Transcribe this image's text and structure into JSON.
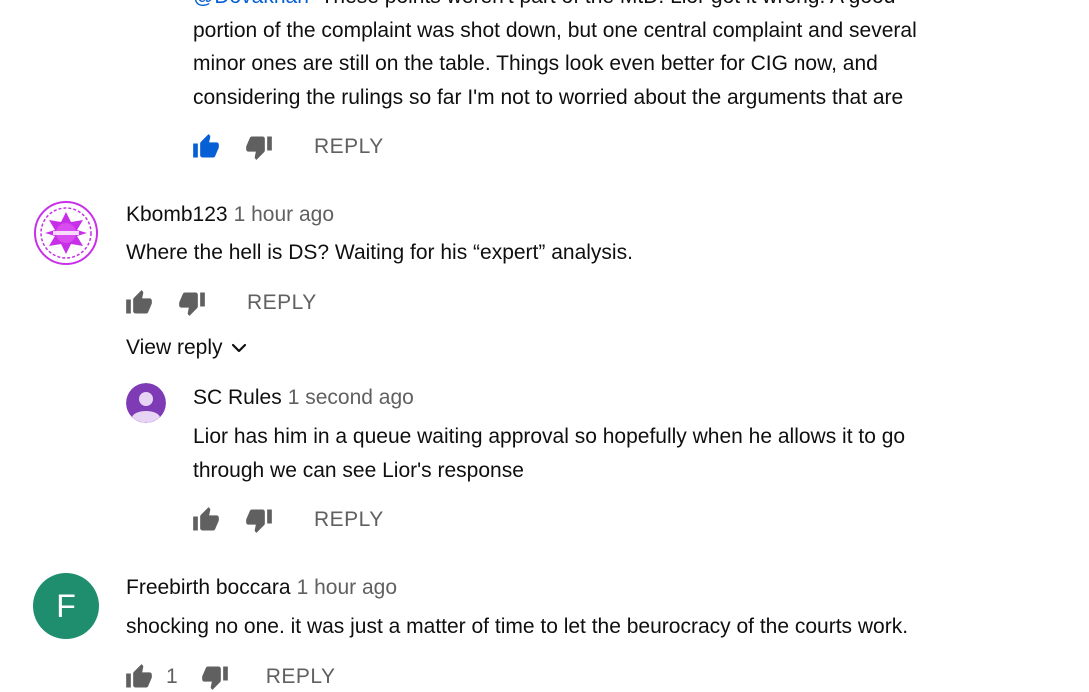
{
  "top_comment": {
    "lines": [
      "portion of the complaint was shot down, but one central complaint and several",
      "minor ones are still on the table. Things look even better for CIG now, and",
      "considering the rulings so far I'm not to worried about the arguments that are"
    ],
    "reply_label": "REPLY"
  },
  "comments": [
    {
      "author": "Kbomb123",
      "time": "1 hour ago",
      "text": "Where the hell is DS? Waiting for his “expert” analysis.",
      "reply_label": "REPLY",
      "view_reply_label": "View reply",
      "avatar": {
        "color": "#c830e8"
      }
    },
    {
      "author": "SC Rules",
      "time": "1 second ago",
      "lines": [
        "Lior has him in a queue waiting approval so hopefully when he allows it to go",
        "through we can see Lior's response"
      ],
      "reply_label": "REPLY",
      "avatar": {
        "color": "#7e3bb5"
      }
    },
    {
      "author": "Freebirth boccara",
      "time": "1 hour ago",
      "text": "shocking no one. it was just a matter of time to let the beurocracy of the courts work.",
      "like_count": "1",
      "reply_label": "REPLY",
      "avatar": {
        "letter": "F",
        "color": "#1e8e6e"
      }
    }
  ],
  "icons": {
    "like": "thumbs-up-icon",
    "dislike": "thumbs-down-icon",
    "expand": "chevron-down-icon"
  },
  "colors": {
    "link": "#065fd4",
    "active_like": "#065fd4",
    "muted": "#606060"
  }
}
